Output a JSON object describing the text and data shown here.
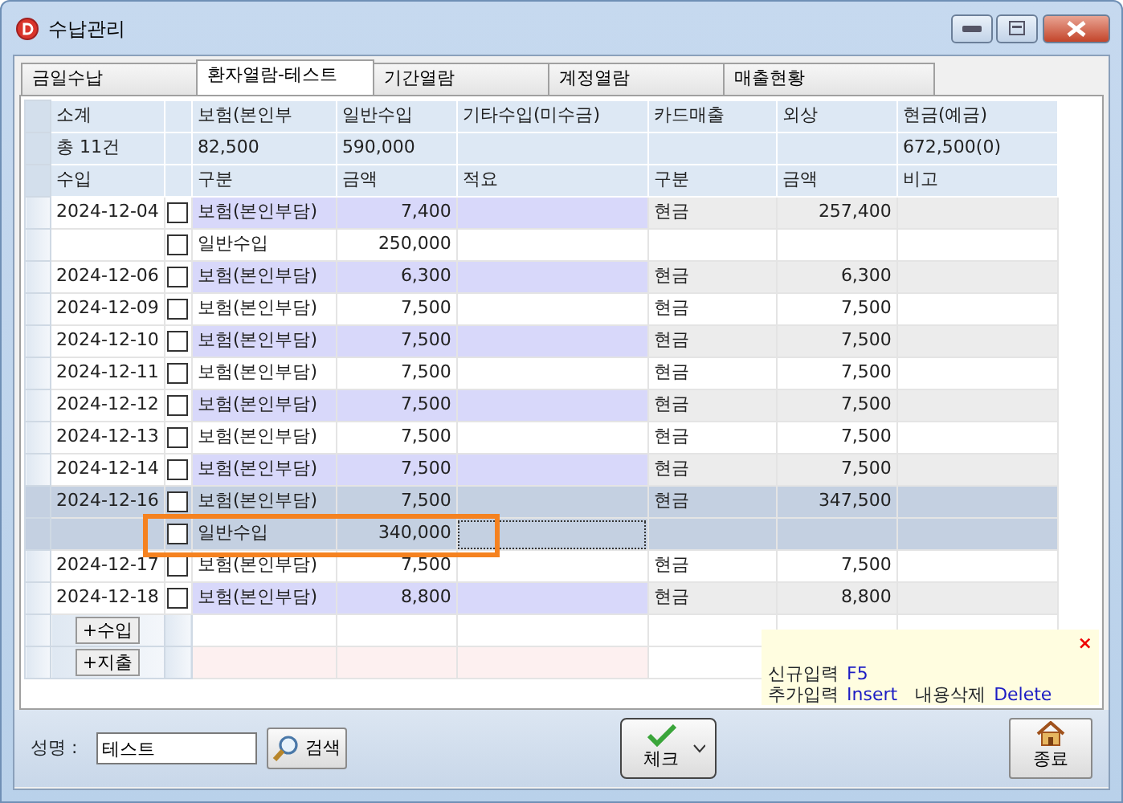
{
  "window": {
    "title": "수납관리"
  },
  "tabs": [
    {
      "label": "금일수납",
      "selected": false
    },
    {
      "label": "환자열람-테스트",
      "selected": true
    },
    {
      "label": "기간열람",
      "selected": false
    },
    {
      "label": "계정열람",
      "selected": false
    },
    {
      "label": "매출현황",
      "selected": false
    }
  ],
  "summary": [
    {
      "header": "소계",
      "value": "총 11건"
    },
    {
      "header": "보험(본인부",
      "value": "82,500"
    },
    {
      "header": "일반수입",
      "value": "590,000"
    },
    {
      "header": "기타수입(미수금)"
    },
    {
      "header": "카드매출"
    },
    {
      "header": "외상"
    },
    {
      "header": "현금(예금)",
      "value": "672,500(0)"
    }
  ],
  "table": {
    "columns": [
      "수입",
      "구분",
      "금액",
      "적요",
      "구분",
      "금액",
      "비고"
    ],
    "rows": [
      {
        "date": "2024-12-04",
        "checked": false,
        "kind": "보험(본인부담)",
        "amount": "7,400",
        "pay": "현금",
        "pay_amount": "257,400",
        "selected": false,
        "focused": false,
        "highlighted": false
      },
      {
        "checked": false,
        "kind": "일반수입",
        "amount": "250,000",
        "selected": false,
        "focused": false,
        "highlighted": false
      },
      {
        "date": "2024-12-06",
        "checked": false,
        "kind": "보험(본인부담)",
        "amount": "6,300",
        "pay": "현금",
        "pay_amount": "6,300",
        "selected": false,
        "focused": false,
        "highlighted": false
      },
      {
        "date": "2024-12-09",
        "checked": false,
        "kind": "보험(본인부담)",
        "amount": "7,500",
        "pay": "현금",
        "pay_amount": "7,500",
        "selected": false,
        "focused": false,
        "highlighted": false
      },
      {
        "date": "2024-12-10",
        "checked": false,
        "kind": "보험(본인부담)",
        "amount": "7,500",
        "pay": "현금",
        "pay_amount": "7,500",
        "selected": false,
        "focused": false,
        "highlighted": false
      },
      {
        "date": "2024-12-11",
        "checked": false,
        "kind": "보험(본인부담)",
        "amount": "7,500",
        "pay": "현금",
        "pay_amount": "7,500",
        "selected": false,
        "focused": false,
        "highlighted": false
      },
      {
        "date": "2024-12-12",
        "checked": false,
        "kind": "보험(본인부담)",
        "amount": "7,500",
        "pay": "현금",
        "pay_amount": "7,500",
        "selected": false,
        "focused": false,
        "highlighted": false
      },
      {
        "date": "2024-12-13",
        "checked": false,
        "kind": "보험(본인부담)",
        "amount": "7,500",
        "pay": "현금",
        "pay_amount": "7,500",
        "selected": false,
        "focused": false,
        "highlighted": false
      },
      {
        "date": "2024-12-14",
        "checked": false,
        "kind": "보험(본인부담)",
        "amount": "7,500",
        "pay": "현금",
        "pay_amount": "7,500",
        "selected": false,
        "focused": false,
        "highlighted": false
      },
      {
        "date": "2024-12-16",
        "checked": false,
        "kind": "보험(본인부담)",
        "amount": "7,500",
        "pay": "현금",
        "pay_amount": "347,500",
        "selected": true,
        "focused": false,
        "highlighted": false
      },
      {
        "checked": false,
        "kind": "일반수입",
        "amount": "340,000",
        "selected": true,
        "focused": true,
        "highlighted": true
      },
      {
        "date": "2024-12-17",
        "checked": false,
        "kind": "보험(본인부담)",
        "amount": "7,500",
        "pay": "현금",
        "pay_amount": "7,500",
        "selected": false,
        "focused": false,
        "highlighted": false
      },
      {
        "date": "2024-12-18",
        "checked": false,
        "kind": "보험(본인부담)",
        "amount": "8,800",
        "pay": "현금",
        "pay_amount": "8,800",
        "selected": false,
        "focused": false,
        "highlighted": false
      }
    ],
    "actions": [
      {
        "label": "+수입",
        "kind": "income"
      },
      {
        "label": "+지출",
        "kind": "expense"
      }
    ]
  },
  "hint": {
    "close": "×",
    "lines": [
      [
        {
          "label": "신규입력",
          "key": "F5"
        }
      ],
      [
        {
          "label": "추가입력",
          "key": "Insert"
        },
        {
          "label": "내용삭제",
          "key": "Delete"
        }
      ]
    ]
  },
  "footer": {
    "name_label": "성명 :",
    "name_value": "테스트",
    "search": "검색",
    "check": "체크",
    "exit": "종료"
  }
}
